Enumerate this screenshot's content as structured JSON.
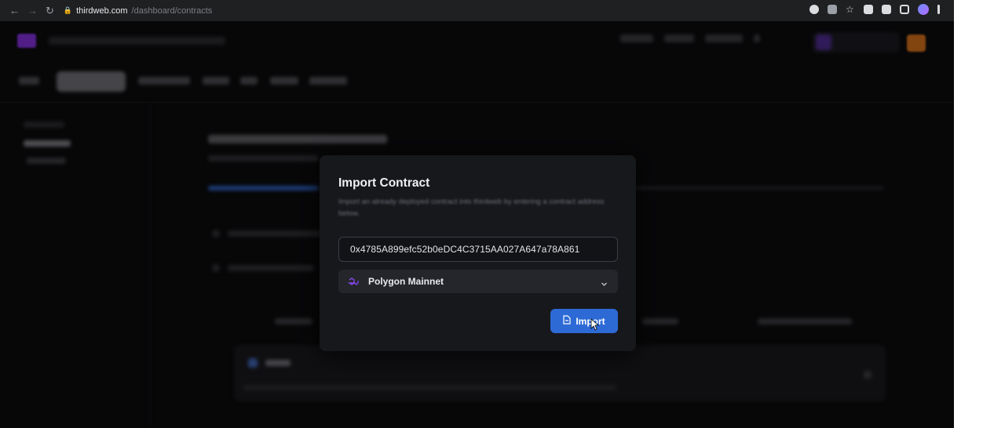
{
  "browser": {
    "url_host": "thirdweb.com",
    "url_path": "/dashboard/contracts"
  },
  "modal": {
    "title": "Import Contract",
    "description": "Import an already deployed contract into thirdweb by entering a contract address below.",
    "address_value": "0x4785A899efc52b0eDC4C3715AA027A647a78A861",
    "network_label": "Polygon Mainnet",
    "import_button": "Import"
  },
  "colors": {
    "accent": "#2d6ad6",
    "polygon": "#8247e5",
    "brand": "#7d2fd1"
  },
  "icons": {
    "chain": "polygon-icon",
    "button": "import-icon",
    "dropdown": "chevron-down-icon"
  }
}
